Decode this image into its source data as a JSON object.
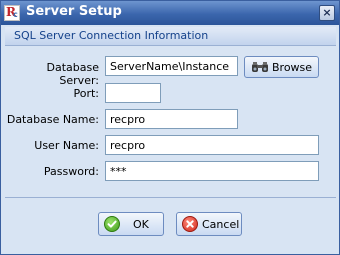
{
  "window": {
    "title": "Server Setup",
    "close_glyph": "×",
    "icon": "app-logo-icon"
  },
  "section": {
    "title": "SQL Server Connection Information"
  },
  "form": {
    "database_server": {
      "label": "Database Server:",
      "value": "ServerName\\Instance"
    },
    "port": {
      "label": "Port:",
      "value": ""
    },
    "database_name": {
      "label": "Database Name:",
      "value": "recpro"
    },
    "user_name": {
      "label": "User Name:",
      "value": "recpro"
    },
    "password": {
      "label": "Password:",
      "value": "***"
    }
  },
  "buttons": {
    "browse": "Browse",
    "ok": "OK",
    "cancel": "Cancel"
  },
  "icons": {
    "browse": "binoculars-icon",
    "ok": "check-circle-icon",
    "cancel": "cancel-circle-icon"
  },
  "colors": {
    "titlebar": "#3b66ad",
    "section_text": "#15428b",
    "dialog_bg": "#d8e4f3"
  }
}
